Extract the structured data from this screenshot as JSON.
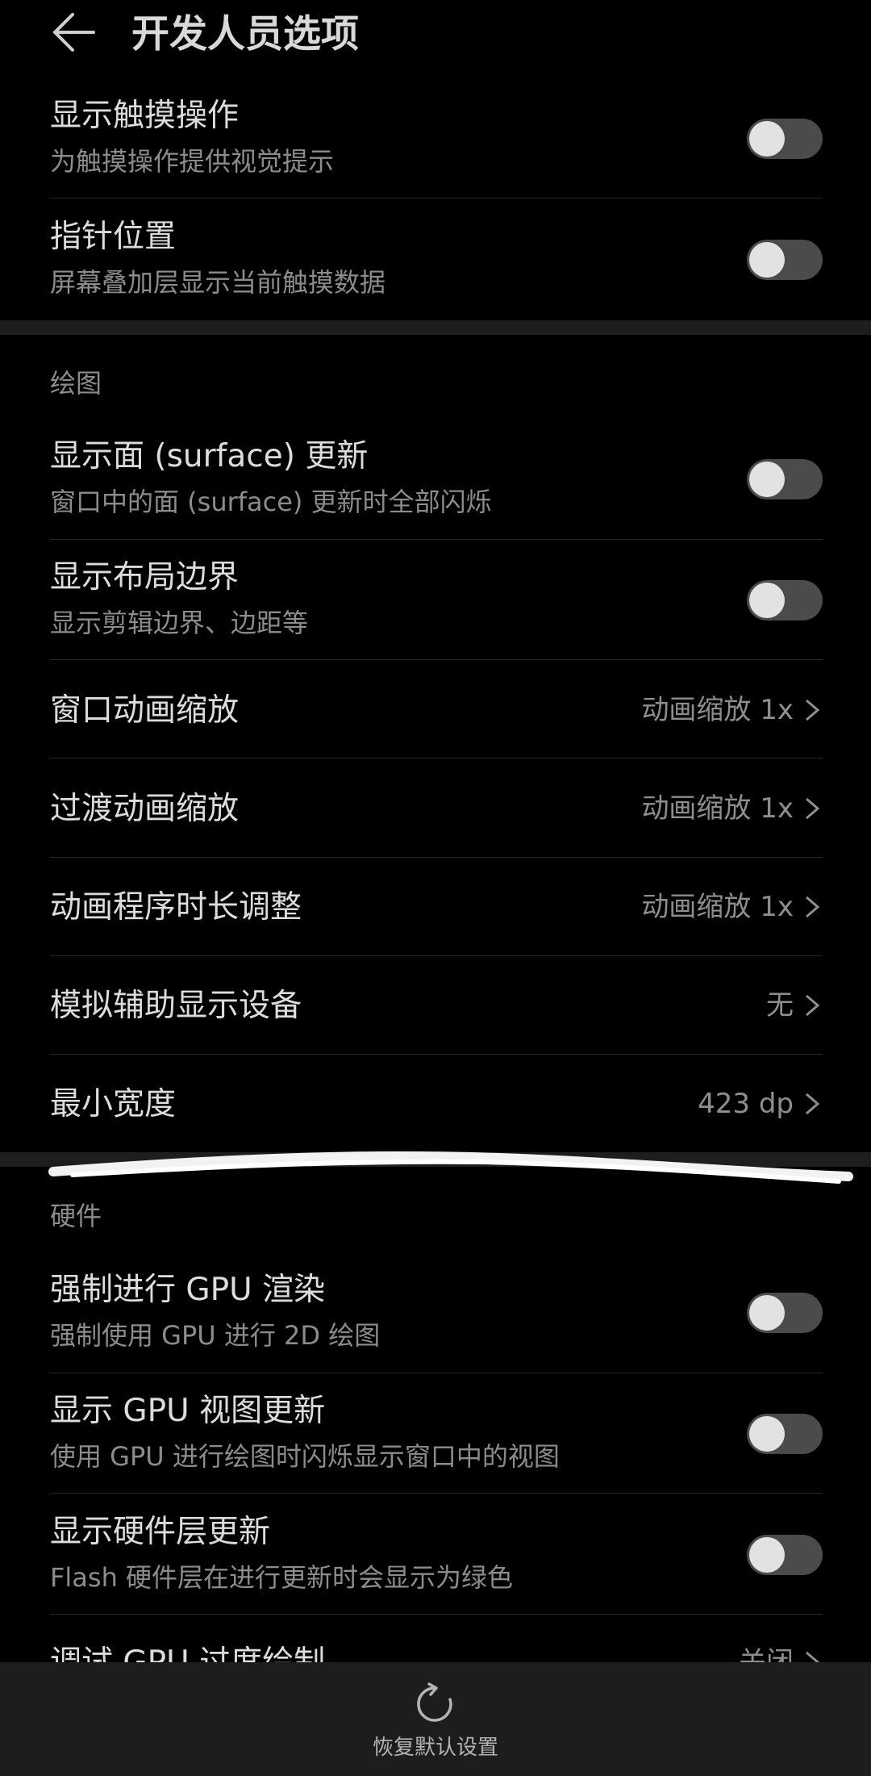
{
  "header": {
    "title": "开发人员选项",
    "back_icon": "arrow-left-icon"
  },
  "rows_top": [
    {
      "title": "显示触摸操作",
      "subtitle": "为触摸操作提供视觉提示",
      "toggle_on": false
    },
    {
      "title": "指针位置",
      "subtitle": "屏幕叠加层显示当前触摸数据",
      "toggle_on": false
    }
  ],
  "section_drawing": {
    "label": "绘图",
    "toggle_rows": [
      {
        "title": "显示面 (surface) 更新",
        "subtitle": "窗口中的面 (surface) 更新时全部闪烁",
        "toggle_on": false
      },
      {
        "title": "显示布局边界",
        "subtitle": "显示剪辑边界、边距等",
        "toggle_on": false
      }
    ],
    "value_rows": [
      {
        "title": "窗口动画缩放",
        "value": "动画缩放 1x"
      },
      {
        "title": "过渡动画缩放",
        "value": "动画缩放 1x"
      },
      {
        "title": "动画程序时长调整",
        "value": "动画缩放 1x"
      },
      {
        "title": "模拟辅助显示设备",
        "value": "无"
      },
      {
        "title": "最小宽度",
        "value": "423 dp"
      }
    ]
  },
  "section_hardware": {
    "label": "硬件",
    "toggle_rows": [
      {
        "title": "强制进行 GPU 渲染",
        "subtitle": "强制使用 GPU 进行 2D 绘图",
        "toggle_on": false
      },
      {
        "title": "显示 GPU 视图更新",
        "subtitle": "使用 GPU 进行绘图时闪烁显示窗口中的视图",
        "toggle_on": false
      },
      {
        "title": "显示硬件层更新",
        "subtitle": "Flash 硬件层在进行更新时会显示为绿色",
        "toggle_on": false
      }
    ],
    "partial_row": {
      "title": "调试 GPU 过度绘制",
      "value": "关闭"
    }
  },
  "bottom_bar": {
    "reset_label": "恢复默认设置",
    "reset_icon": "refresh-icon"
  },
  "colors": {
    "background": "#000000",
    "section_gap": "#1e1e1e",
    "bottom_bar": "#1d1d1d",
    "toggle_track": "#4b4b4b",
    "toggle_knob": "#e2e2e2"
  }
}
